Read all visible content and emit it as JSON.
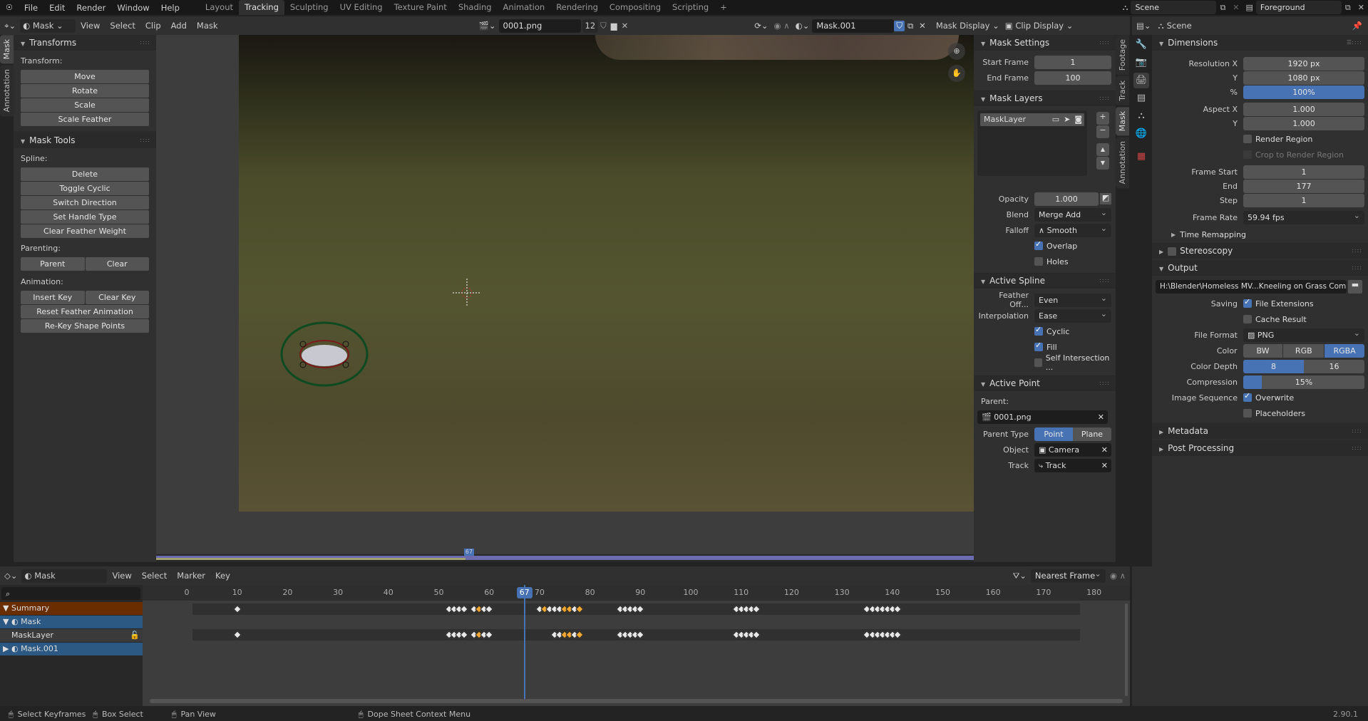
{
  "topbar": {
    "menus": [
      "File",
      "Edit",
      "Render",
      "Window",
      "Help"
    ],
    "workspaces": [
      "Layout",
      "Tracking",
      "Sculpting",
      "UV Editing",
      "Texture Paint",
      "Shading",
      "Animation",
      "Rendering",
      "Compositing",
      "Scripting"
    ],
    "active_workspace": "Tracking",
    "scene": "Scene",
    "view_layer": "Foreground"
  },
  "clip_header": {
    "mode": "Mask",
    "menus": [
      "View",
      "Select",
      "Clip",
      "Add",
      "Mask"
    ],
    "clip_name": "0001.png",
    "users": "12",
    "mask_name": "Mask.001",
    "mask_display": "Mask Display",
    "clip_display": "Clip Display"
  },
  "left_tabs": [
    "Mask",
    "Annotation"
  ],
  "transforms": {
    "title": "Transforms",
    "label": "Transform:",
    "buttons": [
      "Move",
      "Rotate",
      "Scale",
      "Scale Feather"
    ]
  },
  "mask_tools": {
    "title": "Mask Tools",
    "spline_label": "Spline:",
    "spline_buttons": [
      "Delete",
      "Toggle Cyclic",
      "Switch Direction",
      "Set Handle Type",
      "Clear Feather Weight"
    ],
    "parenting_label": "Parenting:",
    "parent": "Parent",
    "clear": "Clear",
    "animation_label": "Animation:",
    "insert_key": "Insert Key",
    "clear_key": "Clear Key",
    "reset_feather": "Reset Feather Animation",
    "rekey": "Re-Key Shape Points"
  },
  "mask_settings": {
    "title": "Mask Settings",
    "start_label": "Start Frame",
    "start": "1",
    "end_label": "End Frame",
    "end": "100"
  },
  "mask_layers": {
    "title": "Mask Layers",
    "layer": "MaskLayer",
    "opacity_label": "Opacity",
    "opacity": "1.000",
    "blend_label": "Blend",
    "blend": "Merge Add",
    "falloff_label": "Falloff",
    "falloff": "Smooth",
    "overlap": "Overlap",
    "overlap_on": true,
    "holes": "Holes",
    "holes_on": false
  },
  "active_spline": {
    "title": "Active Spline",
    "feather_label": "Feather Off...",
    "feather": "Even",
    "interp_label": "Interpolation",
    "interp": "Ease",
    "cyclic": "Cyclic",
    "fill": "Fill",
    "self_int": "Self Intersection ..."
  },
  "active_point": {
    "title": "Active Point",
    "parent_label": "Parent:",
    "parent": "0001.png",
    "parent_type_label": "Parent Type",
    "pt_point": "Point Tra...",
    "pt_plane": "Plane Tra...",
    "object_label": "Object",
    "object": "Camera",
    "track_label": "Track",
    "track": "Track"
  },
  "right_tabs": [
    "Footage",
    "Track",
    "Mask",
    "Annotation"
  ],
  "props": {
    "header": "Scene",
    "dimensions": "Dimensions",
    "res_x_label": "Resolution X",
    "res_x": "1920 px",
    "res_y_label": "Y",
    "res_y": "1080 px",
    "pct_label": "%",
    "pct": "100%",
    "aspect_x_label": "Aspect X",
    "aspect_x": "1.000",
    "aspect_y_label": "Y",
    "aspect_y": "1.000",
    "render_region": "Render Region",
    "crop": "Crop to Render Region",
    "fs_label": "Frame Start",
    "fs": "1",
    "fe_label": "End",
    "fe": "177",
    "step_label": "Step",
    "step": "1",
    "fr_label": "Frame Rate",
    "fr": "59.94 fps",
    "time_remap": "Time Remapping",
    "stereo": "Stereoscopy",
    "output": "Output",
    "path": "H:\\Blender\\Homeless MV...Kneeling on Grass Comp\\",
    "saving_label": "Saving",
    "file_ext": "File Extensions",
    "cache": "Cache Result",
    "format_label": "File Format",
    "format": "PNG",
    "color_label": "Color",
    "colors": [
      "BW",
      "RGB",
      "RGBA"
    ],
    "color_active": "RGBA",
    "depth_label": "Color Depth",
    "depths": [
      "8",
      "16"
    ],
    "depth_active": "8",
    "comp_label": "Compression",
    "comp": "15%",
    "comp_value": 0.15,
    "imgseq_label": "Image Sequence",
    "overwrite": "Overwrite",
    "placeholders": "Placeholders",
    "metadata": "Metadata",
    "post": "Post Processing"
  },
  "dopesheet": {
    "mode": "Mask",
    "menus": [
      "View",
      "Select",
      "Marker",
      "Key"
    ],
    "snap": "Nearest Frame",
    "current_frame": "67",
    "ticks": [
      "0",
      "10",
      "20",
      "30",
      "40",
      "50",
      "60",
      "70",
      "80",
      "90",
      "100",
      "110",
      "120",
      "130",
      "140",
      "150",
      "160",
      "170",
      "180"
    ],
    "channels": [
      "Summary",
      "Mask",
      "MaskLayer",
      "Mask.001"
    ],
    "summary_keys": [
      10,
      52,
      53,
      54,
      55,
      57,
      58,
      59,
      60,
      70,
      71,
      72,
      73,
      74,
      75,
      76,
      77,
      78,
      86,
      87,
      88,
      89,
      90,
      109,
      110,
      111,
      112,
      113,
      135,
      136,
      137,
      138,
      139,
      140,
      141
    ],
    "summary_selected": [
      58,
      71,
      75,
      76,
      78
    ],
    "layer_keys": [
      10,
      52,
      53,
      54,
      55,
      57,
      58,
      59,
      60,
      73,
      74,
      75,
      76,
      77,
      78,
      86,
      87,
      88,
      89,
      90,
      109,
      110,
      111,
      112,
      113,
      135,
      136,
      137,
      138,
      139,
      140,
      141
    ],
    "layer_selected": [
      58,
      75,
      76,
      78
    ]
  },
  "status": {
    "select": "Select Keyframes",
    "box": "Box Select",
    "pan": "Pan View",
    "ctx": "Dope Sheet Context Menu",
    "version": "2.90.1"
  }
}
